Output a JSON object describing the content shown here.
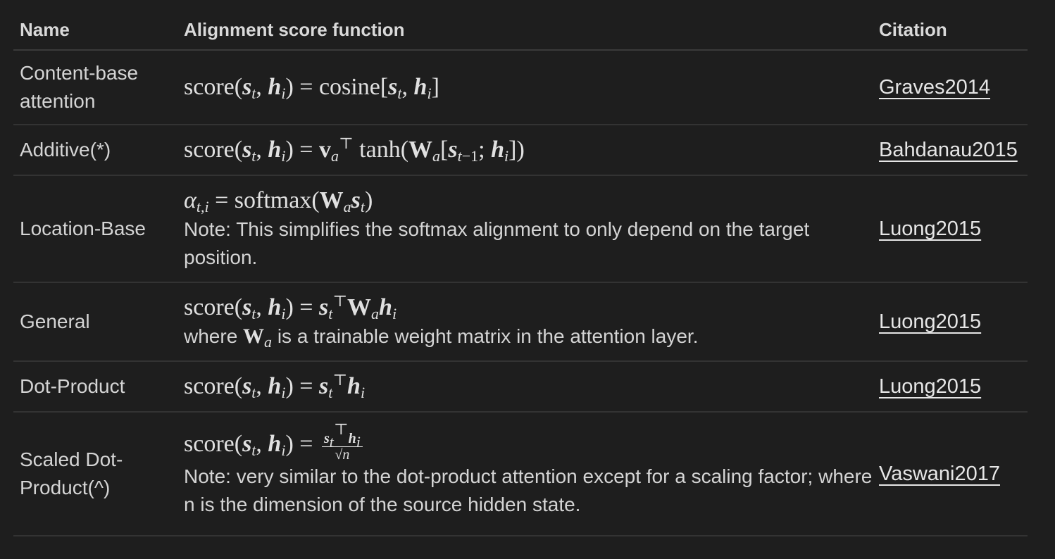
{
  "table": {
    "headers": {
      "name": "Name",
      "function": "Alignment score function",
      "citation": "Citation"
    },
    "rows": [
      {
        "name": "Content-base attention",
        "note": "",
        "citation": "Graves2014"
      },
      {
        "name": "Additive(*)",
        "note": "",
        "citation": "Bahdanau2015"
      },
      {
        "name": "Location-Base",
        "note": "Note: This simplifies the softmax alignment to only depend on the target position.",
        "citation": "Luong2015"
      },
      {
        "name": "General",
        "note_pre": "where",
        "note_post": "is a trainable weight matrix in the attention layer.",
        "citation": "Luong2015"
      },
      {
        "name": "Dot-Product",
        "note": "",
        "citation": "Luong2015"
      },
      {
        "name": "Scaled Dot-Product(^)",
        "note": "Note: very similar to the dot-product attention except for a scaling factor; where n is the dimension of the source hidden state.",
        "citation": "Vaswani2017"
      }
    ]
  }
}
